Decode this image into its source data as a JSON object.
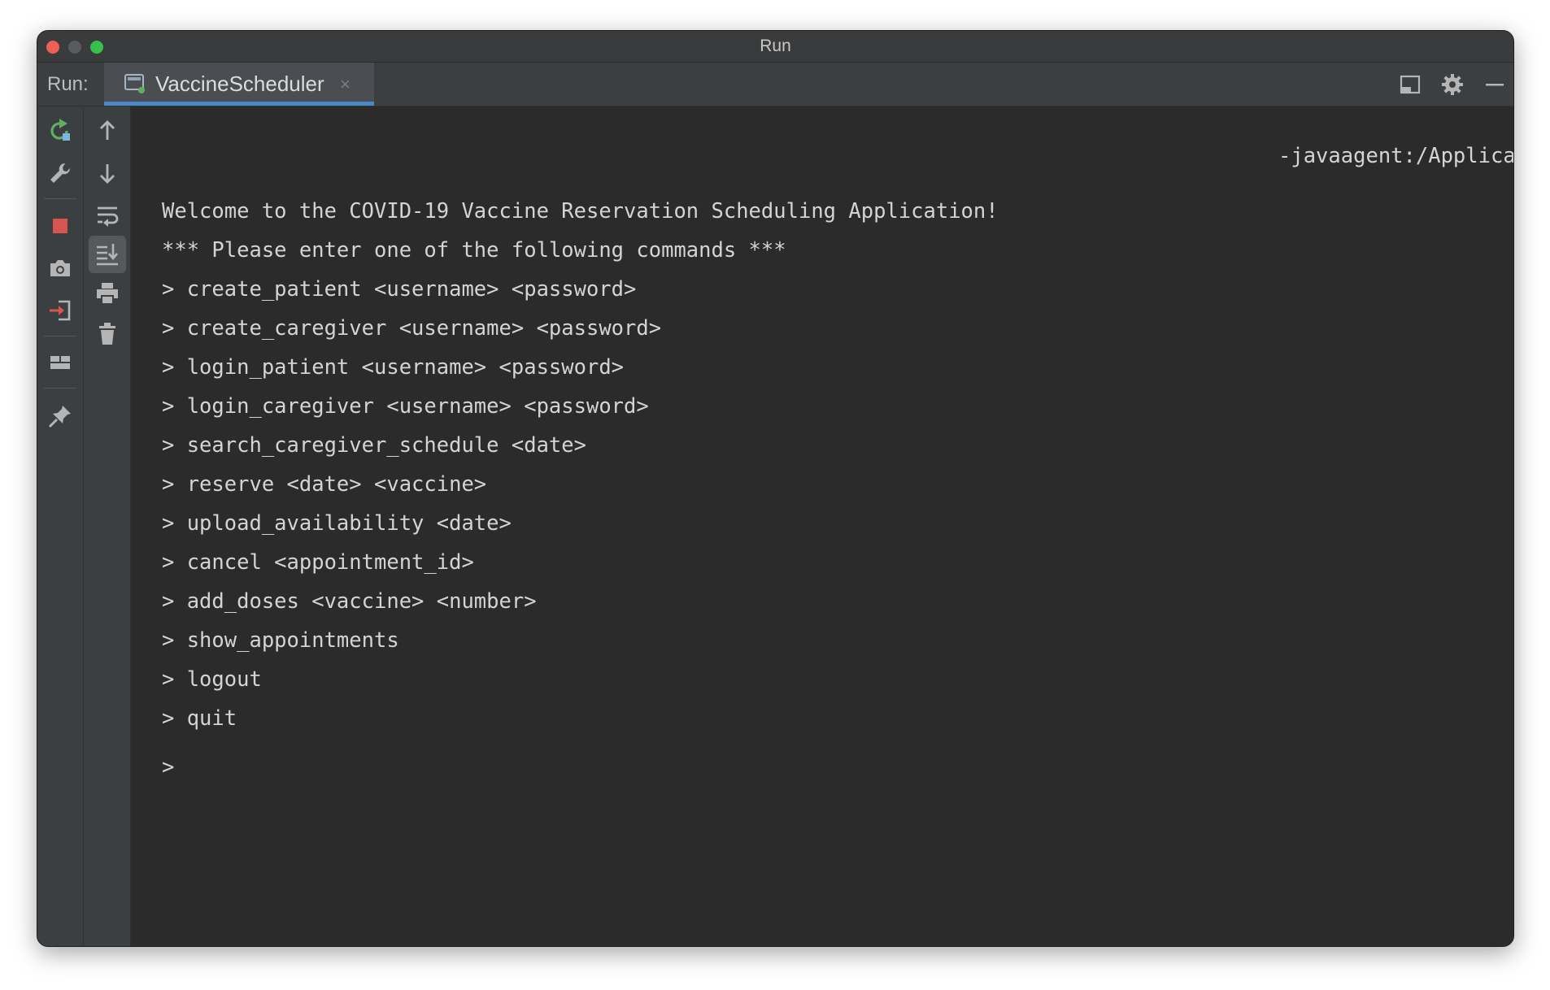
{
  "window": {
    "title": "Run"
  },
  "runbar": {
    "label": "Run:",
    "tab_label": "VaccineScheduler",
    "tab_close": "×"
  },
  "console": {
    "agent_text": "-javaagent:/Applicati",
    "lines": [
      "Welcome to the COVID-19 Vaccine Reservation Scheduling Application!",
      "*** Please enter one of the following commands ***",
      "> create_patient <username> <password>",
      "> create_caregiver <username> <password>",
      "> login_patient <username> <password>",
      "> login_caregiver <username> <password>",
      "> search_caregiver_schedule <date>",
      "> reserve <date> <vaccine>",
      "> upload_availability <date>",
      "> cancel <appointment_id>",
      "> add_doses <vaccine> <number>",
      "> show_appointments",
      "> logout",
      "> quit"
    ],
    "prompt": ">"
  },
  "colors": {
    "accent": "#4a88c7",
    "rerun": "#5fb05f",
    "stop": "#d9534f",
    "background": "#2b2b2b"
  }
}
